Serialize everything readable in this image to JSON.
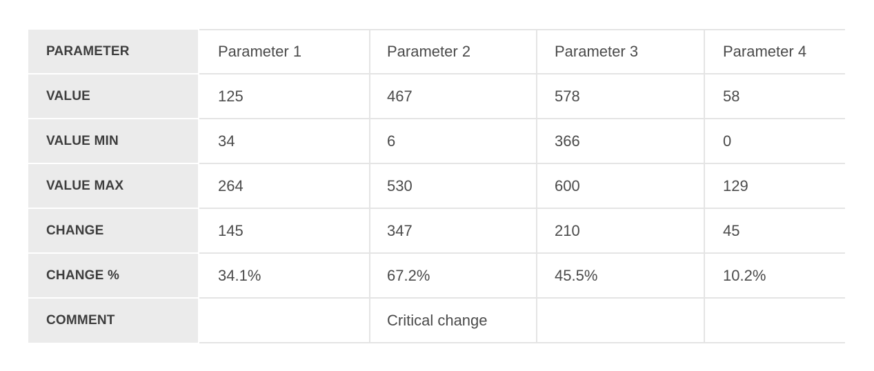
{
  "columns": [
    "Parameter 1",
    "Parameter 2",
    "Parameter 3",
    "Parameter 4"
  ],
  "rows": [
    {
      "label": "PARAMETER",
      "values": [
        "Parameter 1",
        "Parameter 2",
        "Parameter 3",
        "Parameter 4"
      ]
    },
    {
      "label": "VALUE",
      "values": [
        "125",
        "467",
        "578",
        "58"
      ]
    },
    {
      "label": "VALUE MIN",
      "values": [
        "34",
        "6",
        "366",
        "0"
      ]
    },
    {
      "label": "VALUE MAX",
      "values": [
        "264",
        "530",
        "600",
        "129"
      ]
    },
    {
      "label": "CHANGE",
      "values": [
        "145",
        "347",
        "210",
        "45"
      ]
    },
    {
      "label": "CHANGE %",
      "values": [
        "34.1%",
        "67.2%",
        "45.5%",
        "10.2%"
      ]
    },
    {
      "label": "COMMENT",
      "values": [
        "",
        "Critical change",
        "",
        ""
      ]
    }
  ],
  "colors": {
    "label_background": "#ebebeb",
    "label_text": "#3d3d3d",
    "cell_text": "#4a4a4a",
    "grid_line": "#e4e4e4"
  }
}
